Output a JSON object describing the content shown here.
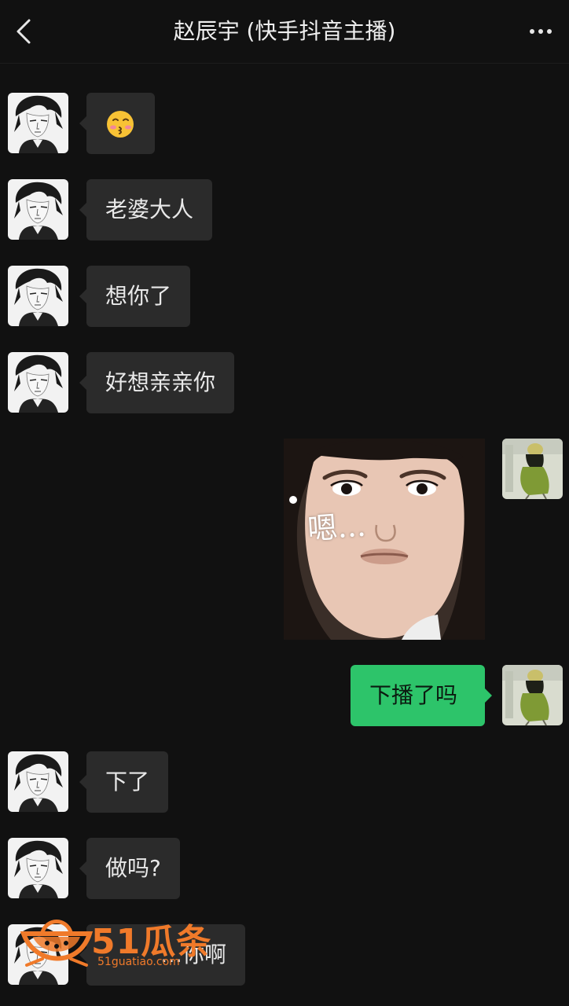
{
  "header": {
    "title": "赵辰宇 (快手抖音主播)",
    "back_icon": "chevron-left-icon",
    "more_icon": "more-dots-icon"
  },
  "messages": [
    {
      "direction": "incoming",
      "type": "emoji",
      "emoji": "😚"
    },
    {
      "direction": "incoming",
      "type": "text",
      "text": "老婆大人"
    },
    {
      "direction": "incoming",
      "type": "text",
      "text": "想你了"
    },
    {
      "direction": "incoming",
      "type": "text",
      "text": "好想亲亲你"
    },
    {
      "direction": "outgoing",
      "type": "image",
      "caption": "嗯..."
    },
    {
      "direction": "outgoing",
      "type": "text",
      "text": "下播了吗"
    },
    {
      "direction": "incoming",
      "type": "text",
      "text": "下了"
    },
    {
      "direction": "incoming",
      "type": "text",
      "text": "做吗?"
    },
    {
      "direction": "incoming",
      "type": "text",
      "text": "…你啊"
    }
  ],
  "watermark": {
    "brand": "51瓜条",
    "url": "51guatiao.com"
  },
  "colors": {
    "background": "#111111",
    "incoming_bubble": "#2b2b2b",
    "outgoing_bubble": "#2dc46a",
    "watermark": "#f07a2a"
  }
}
